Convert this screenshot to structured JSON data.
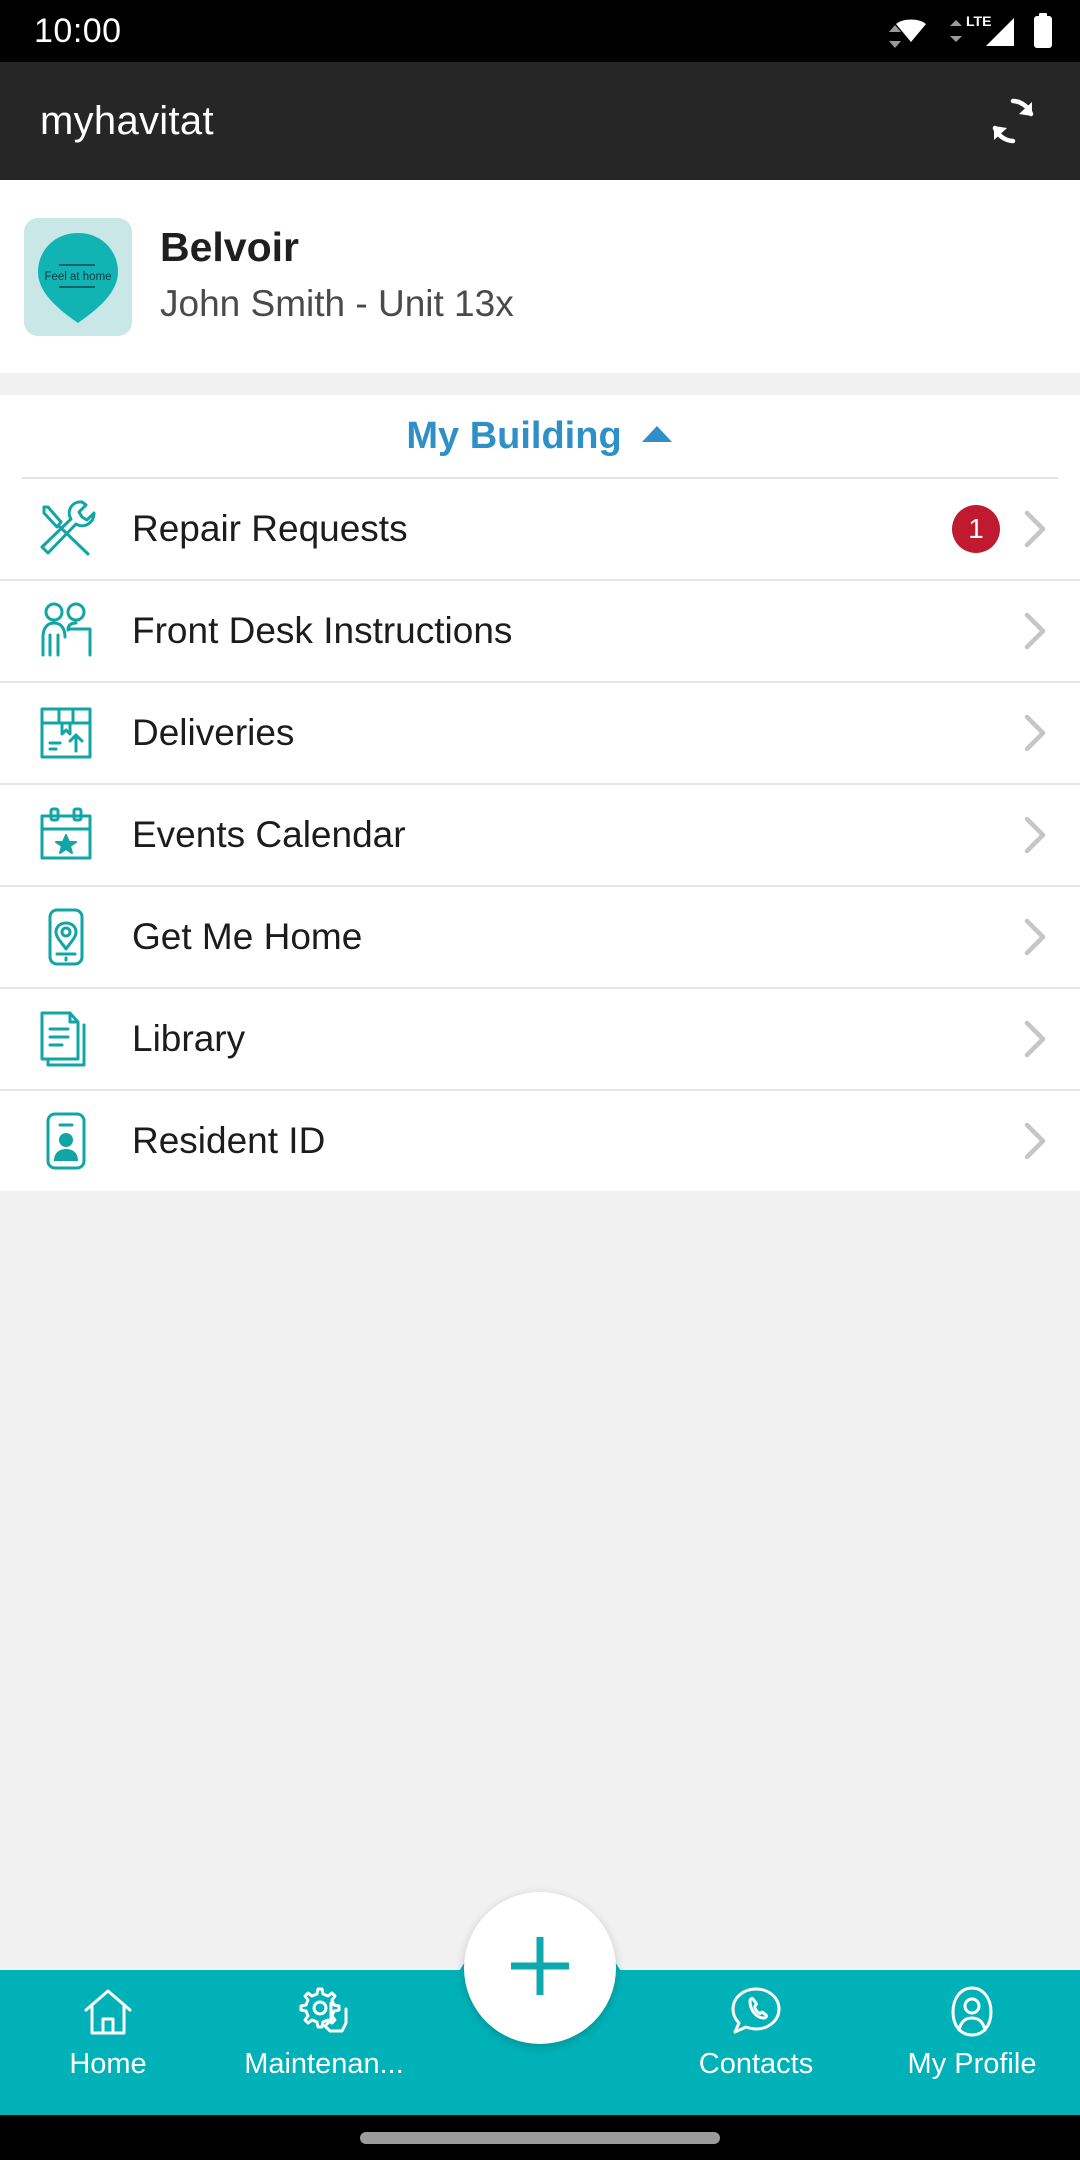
{
  "status_bar": {
    "clock": "10:00",
    "icons": [
      "wifi-icon",
      "lte-signal-icon",
      "battery-icon"
    ],
    "network_label": "LTE"
  },
  "app_bar": {
    "title": "myhavitat",
    "action_icon": "refresh-sync-icon"
  },
  "property_card": {
    "logo_text": "Feel at home",
    "name": "Belvoir",
    "subtitle": "John Smith - Unit 13x"
  },
  "section": {
    "title": "My Building",
    "caret": "chevron-up-icon",
    "expanded": true
  },
  "menu_items": [
    {
      "label": "Repair Requests",
      "icon": "tools-icon",
      "badge": "1",
      "chevron": "chevron-right-icon"
    },
    {
      "label": "Front Desk Instructions",
      "icon": "front-desk-icon",
      "badge": null,
      "chevron": "chevron-right-icon"
    },
    {
      "label": "Deliveries",
      "icon": "package-icon",
      "badge": null,
      "chevron": "chevron-right-icon"
    },
    {
      "label": "Events Calendar",
      "icon": "calendar-icon",
      "badge": null,
      "chevron": "chevron-right-icon"
    },
    {
      "label": "Get Me Home",
      "icon": "phone-pin-icon",
      "badge": null,
      "chevron": "chevron-right-icon"
    },
    {
      "label": "Library",
      "icon": "documents-icon",
      "badge": null,
      "chevron": "chevron-right-icon"
    },
    {
      "label": "Resident ID",
      "icon": "id-badge-icon",
      "badge": null,
      "chevron": "chevron-right-icon"
    }
  ],
  "bottom_nav": {
    "items": [
      {
        "label": "Home",
        "icon": "house-icon"
      },
      {
        "label": "Maintenan...",
        "icon": "gear-hand-icon"
      },
      {
        "label": "Contacts",
        "icon": "phone-bubble-icon"
      },
      {
        "label": "My Profile",
        "icon": "person-icon"
      }
    ],
    "fab": {
      "icon": "plus-icon",
      "label": ""
    }
  },
  "colors": {
    "teal": "#00b2b8",
    "teal_icon": "#12a5a5",
    "logo_bg": "#c9e7e7",
    "accent_blue": "#2f8fc7",
    "badge_red": "#bf1a2f",
    "appbar_bg": "#262626",
    "page_bg": "#f1f1f1"
  }
}
